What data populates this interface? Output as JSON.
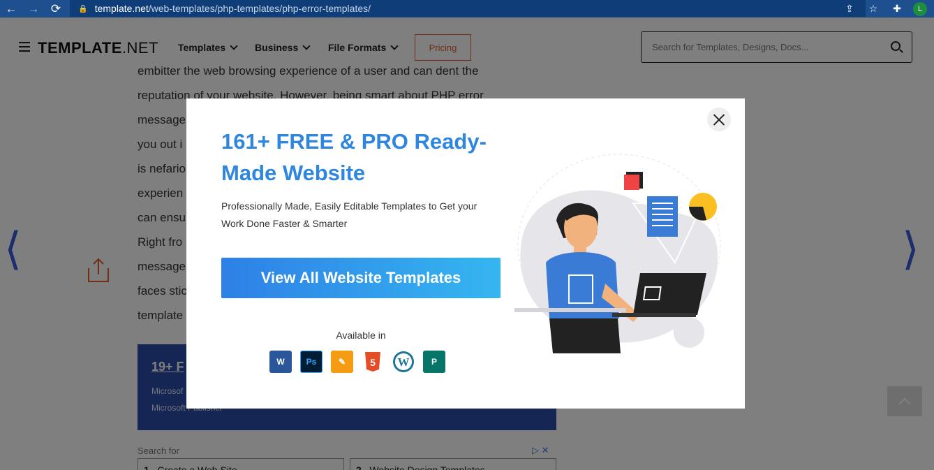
{
  "browser": {
    "url_host": "template.net",
    "url_path": "/web-templates/php-templates/php-error-templates/",
    "profile_initial": "L"
  },
  "header": {
    "logo_bold": "TEMPLATE",
    "logo_light": ".NET",
    "nav": [
      "Templates",
      "Business",
      "File Formats"
    ],
    "pricing_label": "Pricing",
    "search_placeholder": "Search for Templates, Designs, Docs..."
  },
  "article": {
    "lines": [
      "embitter the web browsing experience of a user and can dent the",
      "reputation of your website. However, being smart about PHP error",
      "message",
      "you out i",
      "is nefario",
      "experien",
      "can ensu",
      "Right fro",
      "message",
      "faces stic",
      "template"
    ],
    "promo_title": "19+ F",
    "promo_line1": "Microsof",
    "promo_line2": "Microsoft Publisher",
    "search_for": "Search for",
    "results": [
      {
        "num": "1",
        "text": "Create a Web Site"
      },
      {
        "num": "2",
        "text": "Website Design Templates"
      }
    ]
  },
  "modal": {
    "title": "161+ FREE & PRO Ready-Made Website",
    "subtitle": "Professionally Made, Easily Editable Templates to Get your Work Done Faster & Smarter",
    "cta_label": "View All Website Templates",
    "available_label": "Available in",
    "formats": [
      {
        "name": "Microsoft Word",
        "glyph": "W"
      },
      {
        "name": "Adobe Photoshop",
        "glyph": "Ps"
      },
      {
        "name": "Apple Pages",
        "glyph": "✎"
      },
      {
        "name": "HTML5",
        "glyph": "5"
      },
      {
        "name": "WordPress",
        "glyph": "W"
      },
      {
        "name": "Microsoft Publisher",
        "glyph": "P"
      }
    ]
  },
  "colors": {
    "accent_blue": "#2e86de",
    "pricing_orange": "#e25b2a",
    "chrome_blue": "#1e4f8f",
    "overlay": "rgba(0,0,0,0.5)"
  }
}
